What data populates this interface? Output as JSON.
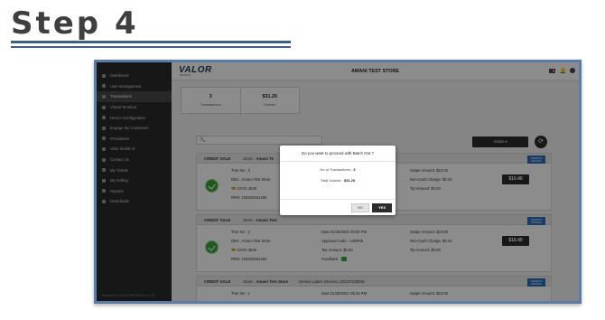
{
  "heading": "Step 4",
  "app": {
    "logo": "VALOR",
    "logo_sub": "PAYTECH",
    "store_title": "AMANI TEST STORE"
  },
  "sidebar": {
    "items": [
      {
        "label": "Dashboard"
      },
      {
        "label": "User Management"
      },
      {
        "label": "Transactions"
      },
      {
        "label": "Virtual Terminal"
      },
      {
        "label": "Device Configuration"
      },
      {
        "label": "Engage My Customers"
      },
      {
        "label": "Promotions"
      },
      {
        "label": "Valor Shield VI"
      },
      {
        "label": "Contact Us"
      },
      {
        "label": "My Tickets"
      },
      {
        "label": "My Setting"
      },
      {
        "label": "Reports"
      },
      {
        "label": "Downloads"
      }
    ],
    "footer": "Powered by VALOR PAYTECH v1.1.23"
  },
  "stats": {
    "transactions_value": "3",
    "transactions_label": "Transactions",
    "volume_value": "$31.20",
    "volume_label": "Volume"
  },
  "search": {
    "placeholder": "🔍"
  },
  "toolbar": {
    "action_label": "Action ▾"
  },
  "cards": [
    {
      "type": "CREDIT SALE",
      "store_label": "Store :",
      "store": "Amani Te",
      "tran_no": "Tran No : 3",
      "dba": "DBA : Amani Test Store",
      "card": "XXXX 3546",
      "rrn": "RRN: 102502501456",
      "swipe": "Swipe Amount: $10.00",
      "non_cash": "Non-Cash Charge: $0.40",
      "tip": "Tip Amount: $0.00",
      "amount": "$10.40",
      "brand": "AMERICAN EXPRESS"
    },
    {
      "type": "CREDIT SALE",
      "store_label": "Store :",
      "store": "Amani Test",
      "tran_no": "Tran No : 2",
      "dba": "DBA : Amani Test Store",
      "card": "XXXX 3546",
      "rrn": "RRN: 102502501452",
      "date": "Date 01/29/2021 05:50 PM",
      "approval": "Approval Code : A45R06",
      "tax": "Tax Amount: $0.00",
      "feedback": "Feedback :",
      "swipe": "Swipe Amount: $10.00",
      "non_cash": "Non-Cash Charge: $0.40",
      "tip": "Tip Amount: $0.00",
      "amount": "$10.40",
      "brand": "AMERICAN EXPRESS"
    },
    {
      "type": "CREDIT SALE",
      "store_label": "Store :",
      "store": "Amani Test Store",
      "device": "Device Label: Device1 (2033723005)",
      "tran_no": "Tran No : 1",
      "date": "Date 01/29/2021 05:34 PM",
      "swipe": "Swipe Amount: $10.00",
      "brand": "AMERICAN EXPRESS"
    }
  ],
  "modal": {
    "title": "Do you want to proceed with Batch Out ?",
    "count_label": "No of Transactions :",
    "count_value": "3",
    "volume_label": "Total Volume :",
    "volume_value": "$31.20",
    "no_label": "NO",
    "yes_label": "YES"
  }
}
